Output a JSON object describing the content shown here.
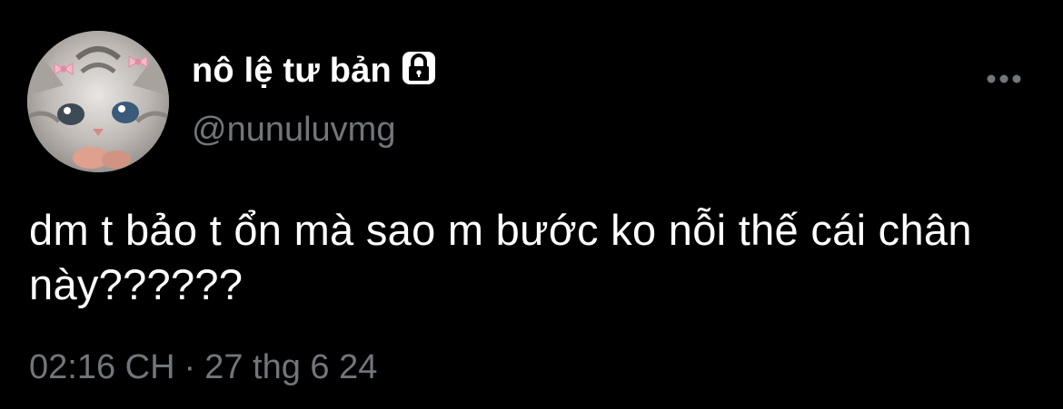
{
  "user": {
    "display_name": "nô lệ tư bản",
    "handle": "@nunuluvmg",
    "locked_icon": "lock-icon",
    "avatar": "kitten-with-bows-avatar"
  },
  "tweet": {
    "text": "dm t bảo t ổn mà sao m bước ko nỗi thế cái chân này??????",
    "time": "02:16 CH",
    "separator": "·",
    "date": "27 thg 6 24"
  },
  "menu": {
    "icon": "more-dots-icon"
  },
  "colors": {
    "background": "#000000",
    "primary_text": "#ffffff",
    "secondary_text": "#71767b"
  }
}
